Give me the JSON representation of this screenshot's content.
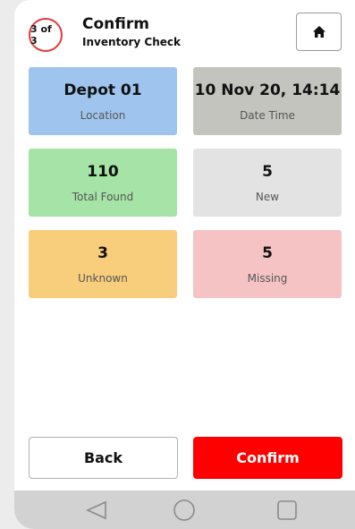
{
  "header": {
    "step": "3 of 3",
    "title": "Confirm",
    "subtitle": "Inventory Check",
    "home_icon": "home-icon"
  },
  "tiles": [
    {
      "value": "Depot 01",
      "label": "Location",
      "color": "#9fc5ee"
    },
    {
      "value": "10 Nov 20, 14:14",
      "label": "Date Time",
      "color": "#c4c4bf"
    },
    {
      "value": "110",
      "label": "Total Found",
      "color": "#a6e3a6"
    },
    {
      "value": "5",
      "label": "New",
      "color": "#e3e3e3"
    },
    {
      "value": "3",
      "label": "Unknown",
      "color": "#f8cd7c"
    },
    {
      "value": "5",
      "label": "Missing",
      "color": "#f6c3c5"
    }
  ],
  "actions": {
    "back_label": "Back",
    "confirm_label": "Confirm",
    "confirm_color": "#ff0000"
  },
  "navbar": {
    "icons": [
      "back-triangle-icon",
      "home-circle-icon",
      "recents-square-icon"
    ]
  }
}
